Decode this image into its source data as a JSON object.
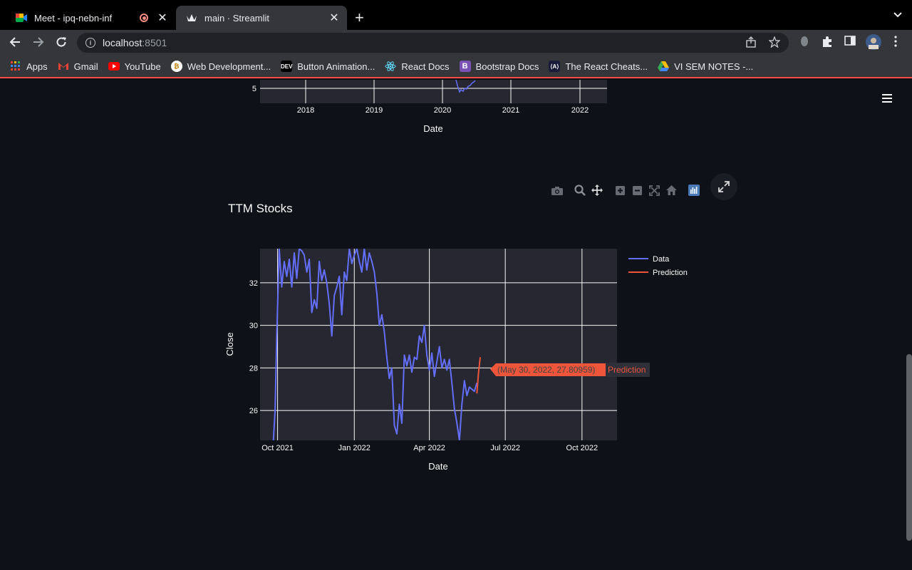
{
  "browser": {
    "tabs": [
      {
        "title": "Meet - ipq-nebn-inf",
        "active": false
      },
      {
        "title": "main · Streamlit",
        "active": true
      }
    ],
    "url_host": "localhost",
    "url_port": ":8501",
    "bookmarks": [
      {
        "label": "Apps",
        "icon": "apps-grid-icon"
      },
      {
        "label": "Gmail",
        "icon": "gmail-icon"
      },
      {
        "label": "YouTube",
        "icon": "youtube-icon"
      },
      {
        "label": "Web Development...",
        "icon": "web-dev-icon"
      },
      {
        "label": "Button Animation...",
        "icon": "dev-icon"
      },
      {
        "label": "React Docs",
        "icon": "react-icon"
      },
      {
        "label": "Bootstrap Docs",
        "icon": "bootstrap-icon"
      },
      {
        "label": "The React Cheats...",
        "icon": "react-cheatsheet-icon"
      },
      {
        "label": "VI SEM NOTES -...",
        "icon": "google-drive-icon"
      }
    ]
  },
  "colors": {
    "accent": "#ff4b4b",
    "data_line": "#636efa",
    "prediction_line": "#ef553b",
    "plot_bg": "#262730",
    "app_bg": "#0e1117"
  },
  "top_chart": {
    "xlabel": "Date",
    "x_ticks": [
      "2018",
      "2019",
      "2020",
      "2021",
      "2022"
    ],
    "y_ticks": [
      "5"
    ]
  },
  "main_chart": {
    "title": "TTM Stocks",
    "ylabel": "Close",
    "xlabel": "Date",
    "x_ticks": [
      "Oct 2021",
      "Jan 2022",
      "Apr 2022",
      "Jul 2022",
      "Oct 2022"
    ],
    "y_ticks": [
      "32",
      "30",
      "28",
      "26"
    ],
    "legend": [
      "Data",
      "Prediction"
    ],
    "hover_label": "(May 30, 2022, 27.80959)",
    "hover_series": "Prediction"
  },
  "modebar": [
    "camera-icon",
    "zoom-icon",
    "pan-icon",
    "zoom-in-icon",
    "zoom-out-icon",
    "autoscale-icon",
    "reset-axes-icon",
    "plotly-logo-icon"
  ],
  "chart_data": [
    {
      "type": "line",
      "title": "",
      "xlabel": "Date",
      "ylabel": "",
      "x_ticks": [
        "2018",
        "2019",
        "2020",
        "2021",
        "2022"
      ],
      "series": []
    },
    {
      "type": "line",
      "title": "TTM Stocks",
      "xlabel": "Date",
      "ylabel": "Close",
      "ylim": [
        24.6,
        33.6
      ],
      "xlim": [
        "2021-09-10",
        "2022-11-12"
      ],
      "legend": "top-right outside",
      "grid": true,
      "series": [
        {
          "name": "Data",
          "x": [
            "2021-09-26",
            "2021-09-28",
            "2021-09-30",
            "2021-10-03",
            "2021-10-06",
            "2021-10-09",
            "2021-10-12",
            "2021-10-15",
            "2021-10-18",
            "2021-10-21",
            "2021-10-24",
            "2021-10-27",
            "2021-10-30",
            "2021-11-02",
            "2021-11-05",
            "2021-11-08",
            "2021-11-11",
            "2021-11-14",
            "2021-11-17",
            "2021-11-20",
            "2021-11-23",
            "2021-11-26",
            "2021-11-29",
            "2021-12-02",
            "2021-12-05",
            "2021-12-08",
            "2021-12-11",
            "2021-12-14",
            "2021-12-17",
            "2021-12-20",
            "2021-12-23",
            "2021-12-26",
            "2021-12-29",
            "2022-01-01",
            "2022-01-04",
            "2022-01-07",
            "2022-01-10",
            "2022-01-13",
            "2022-01-16",
            "2022-01-19",
            "2022-01-22",
            "2022-01-25",
            "2022-01-28",
            "2022-01-31",
            "2022-02-03",
            "2022-02-06",
            "2022-02-09",
            "2022-02-12",
            "2022-02-15",
            "2022-02-18",
            "2022-02-21",
            "2022-02-24",
            "2022-02-27",
            "2022-03-02",
            "2022-03-05",
            "2022-03-08",
            "2022-03-11",
            "2022-03-14",
            "2022-03-17",
            "2022-03-20",
            "2022-03-23",
            "2022-03-26",
            "2022-03-29",
            "2022-04-01",
            "2022-04-04",
            "2022-04-07",
            "2022-04-10",
            "2022-04-13",
            "2022-04-16",
            "2022-04-19",
            "2022-04-22",
            "2022-04-25",
            "2022-04-28",
            "2022-05-01",
            "2022-05-04",
            "2022-05-07",
            "2022-05-10",
            "2022-05-13",
            "2022-05-16",
            "2022-05-19",
            "2022-05-22",
            "2022-05-25",
            "2022-05-28"
          ],
          "y": [
            24.6,
            26.0,
            29.5,
            33.6,
            31.8,
            33.0,
            32.3,
            33.1,
            31.8,
            33.4,
            32.2,
            33.6,
            33.5,
            33.3,
            32.5,
            33.1,
            30.6,
            31.2,
            30.8,
            33.0,
            32.1,
            32.6,
            32.0,
            31.0,
            29.5,
            31.4,
            31.8,
            32.3,
            30.5,
            32.5,
            32.1,
            33.6,
            32.9,
            33.3,
            33.6,
            33.0,
            32.5,
            33.6,
            32.6,
            33.4,
            33.0,
            32.5,
            31.5,
            30.0,
            30.5,
            29.7,
            28.5,
            27.5,
            28.0,
            25.3,
            24.9,
            26.3,
            25.4,
            28.6,
            28.1,
            28.6,
            27.8,
            28.5,
            28.4,
            29.5,
            29.2,
            30.0,
            28.6,
            27.9,
            28.7,
            27.6,
            28.3,
            29.0,
            28.0,
            28.4,
            27.9,
            28.4,
            27.3,
            26.1,
            25.4,
            24.6,
            26.3,
            27.4,
            26.7,
            27.1,
            27.0,
            26.9,
            27.3
          ]
        },
        {
          "name": "Prediction",
          "x": [
            "2022-05-28",
            "2022-05-30",
            "2022-06-01"
          ],
          "y": [
            26.8,
            27.81,
            28.5
          ]
        }
      ]
    }
  ]
}
